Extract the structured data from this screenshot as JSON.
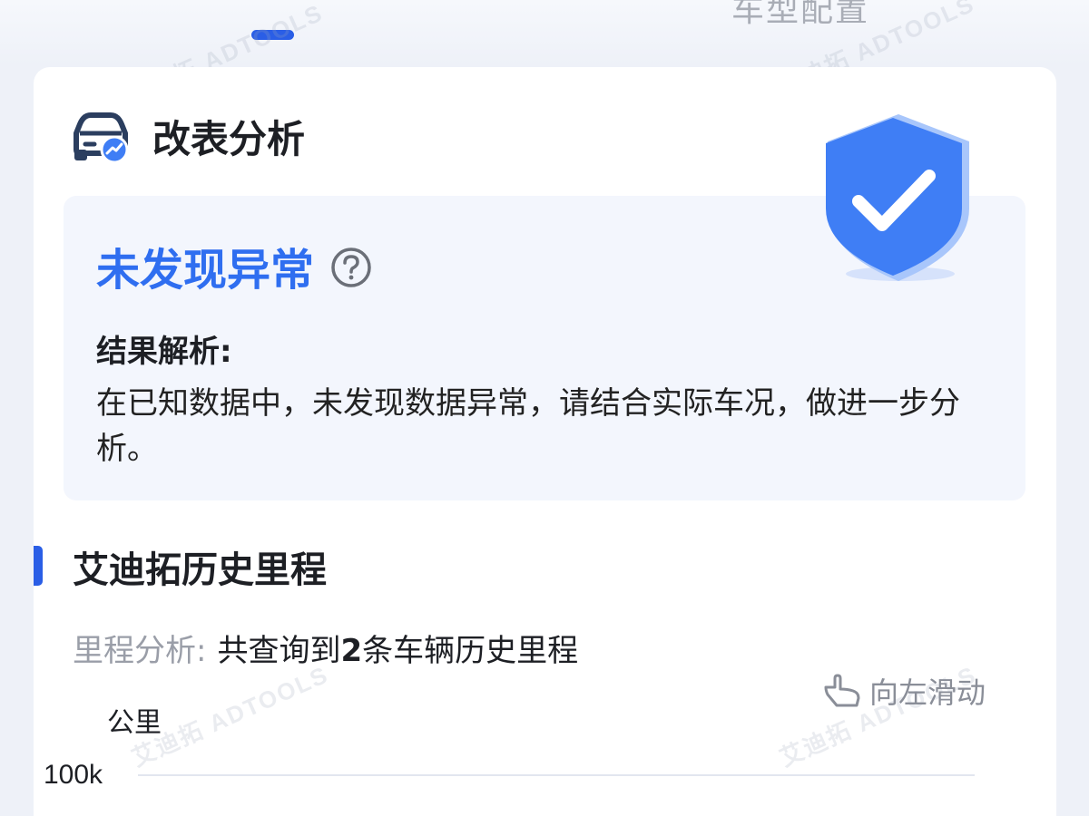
{
  "header": {
    "active_tab": "",
    "other_tab_label": "车型配置"
  },
  "watermark": "艾迪拓 ADTOOLS",
  "modification": {
    "section_title": "改表分析",
    "car_icon": "car-analysis-icon",
    "result_title": "未发现异常",
    "help_icon": "question-circle-icon",
    "shield_icon": "shield-check-icon",
    "analysis_label": "结果解析:",
    "analysis_text": "在已知数据中，未发现数据异常，请结合实际车况，做进一步分析。"
  },
  "history": {
    "section_title": "艾迪拓历史里程",
    "mileage_label": "里程分析:",
    "mileage_value_prefix": "共查询到",
    "mileage_count": "2",
    "mileage_value_suffix": "条车辆历史里程",
    "swipe_icon": "hand-swipe-icon",
    "swipe_hint": "向左滑动"
  },
  "chart_data": {
    "type": "line",
    "ylabel": "公里",
    "y_ticks": [
      "100k"
    ]
  },
  "colors": {
    "accent": "#2a5ee6",
    "result_blue": "#2f6ef0",
    "shield": "#3f7ef5"
  }
}
